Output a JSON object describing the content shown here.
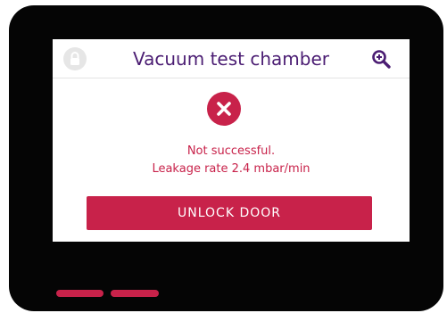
{
  "header": {
    "title": "Vacuum test chamber",
    "left_icon": "lock-icon",
    "right_icon": "zoom-in-icon"
  },
  "status": {
    "icon": "error-x-icon",
    "line1": "Not successful.",
    "line2": "Leakage rate 2.4 mbar/min"
  },
  "actions": {
    "unlock_label": "UNLOCK DOOR"
  },
  "colors": {
    "accent": "#c8224a",
    "title": "#4b1d73",
    "bezel": "#050505"
  }
}
